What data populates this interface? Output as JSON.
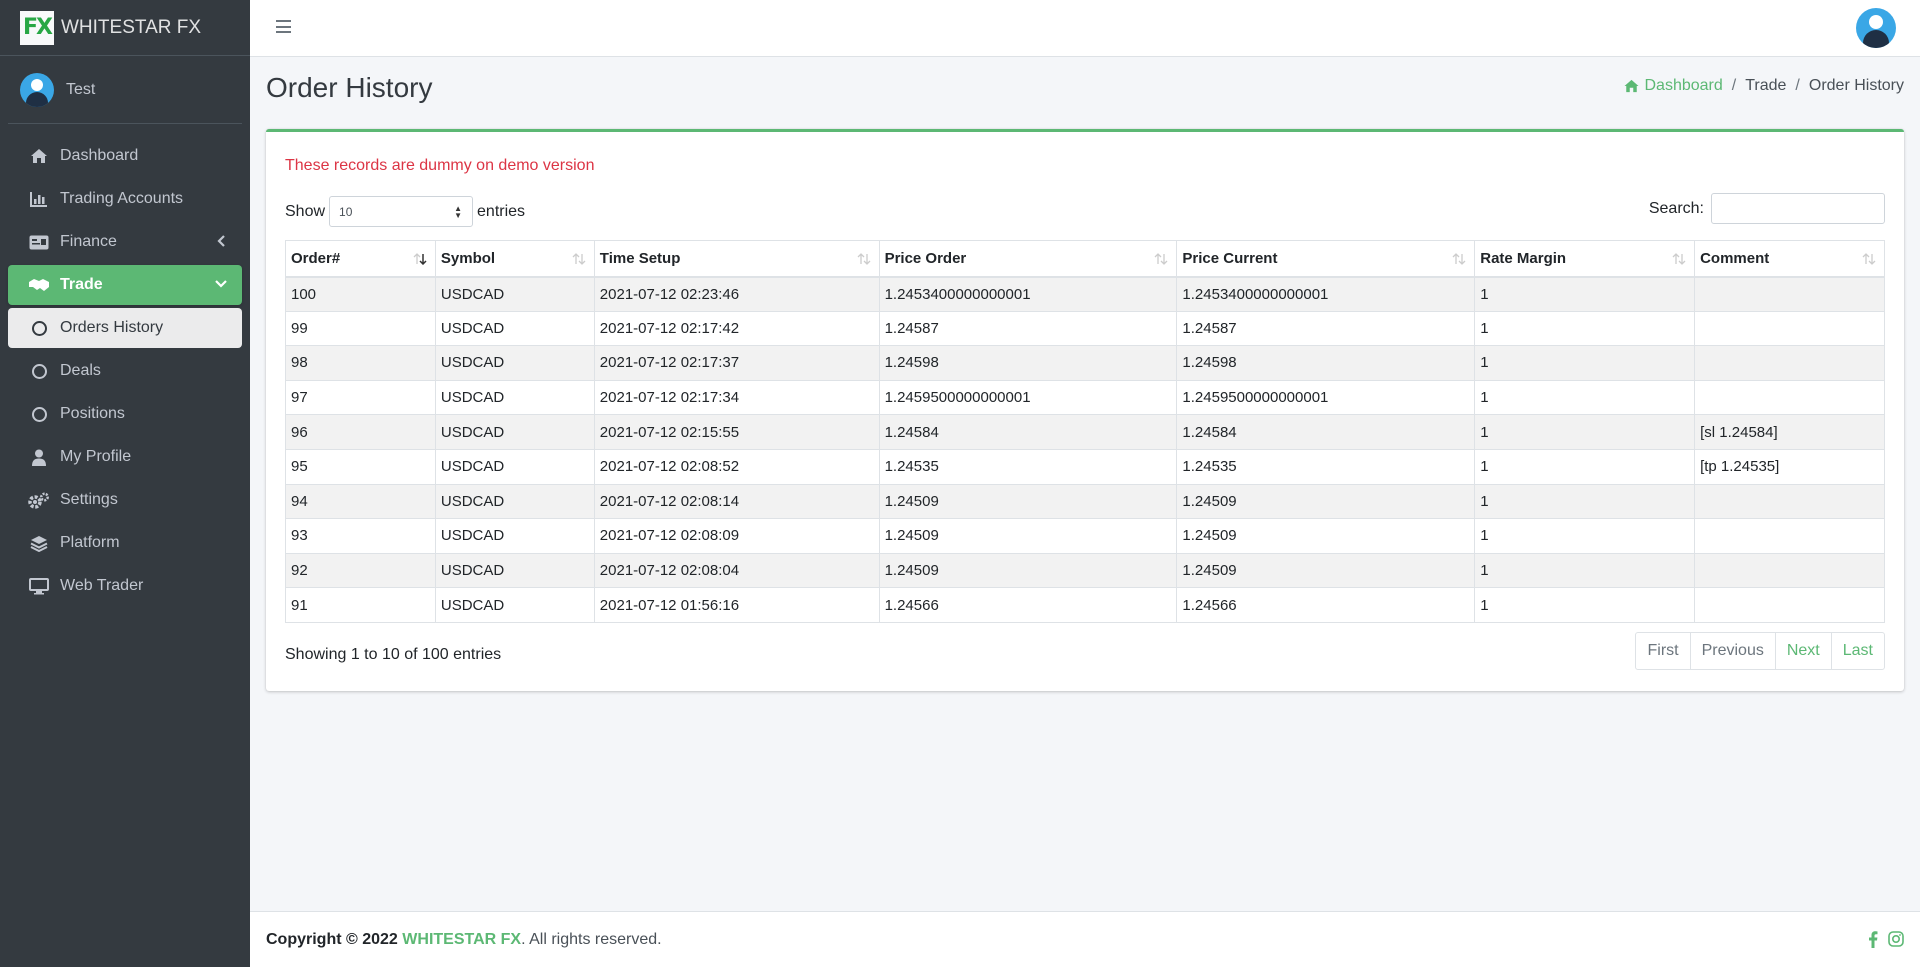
{
  "brand": {
    "logo_text": "FX",
    "name": "WHITESTAR FX"
  },
  "user": {
    "name": "Test"
  },
  "sidebar": {
    "items": [
      {
        "label": "Dashboard",
        "icon": "home-icon"
      },
      {
        "label": "Trading Accounts",
        "icon": "chart-bar-icon"
      },
      {
        "label": "Finance",
        "icon": "money-card-icon"
      },
      {
        "label": "Trade",
        "icon": "handshake-icon"
      },
      {
        "label": "Orders History",
        "icon": "circle-icon"
      },
      {
        "label": "Deals",
        "icon": "circle-icon"
      },
      {
        "label": "Positions",
        "icon": "circle-icon"
      },
      {
        "label": "My Profile",
        "icon": "user-icon"
      },
      {
        "label": "Settings",
        "icon": "cogs-icon"
      },
      {
        "label": "Platform",
        "icon": "layers-icon"
      },
      {
        "label": "Web Trader",
        "icon": "desktop-icon"
      }
    ]
  },
  "page": {
    "title": "Order History"
  },
  "breadcrumb": {
    "home": "Dashboard",
    "trade": "Trade",
    "current": "Order History"
  },
  "card": {
    "demo_note": "These records are dummy on demo version",
    "show_label": "Show",
    "entries_value": "10",
    "entries_label": "entries",
    "search_label": "Search:",
    "info": "Showing 1 to 10 of 100 entries"
  },
  "table": {
    "headers": [
      "Order#",
      "Symbol",
      "Time Setup",
      "Price Order",
      "Price Current",
      "Rate Margin",
      "Comment"
    ],
    "rows": [
      [
        "100",
        "USDCAD",
        "2021-07-12 02:23:46",
        "1.2453400000000001",
        "1.2453400000000001",
        "1",
        ""
      ],
      [
        "99",
        "USDCAD",
        "2021-07-12 02:17:42",
        "1.24587",
        "1.24587",
        "1",
        ""
      ],
      [
        "98",
        "USDCAD",
        "2021-07-12 02:17:37",
        "1.24598",
        "1.24598",
        "1",
        ""
      ],
      [
        "97",
        "USDCAD",
        "2021-07-12 02:17:34",
        "1.2459500000000001",
        "1.2459500000000001",
        "1",
        ""
      ],
      [
        "96",
        "USDCAD",
        "2021-07-12 02:15:55",
        "1.24584",
        "1.24584",
        "1",
        "[sl 1.24584]"
      ],
      [
        "95",
        "USDCAD",
        "2021-07-12 02:08:52",
        "1.24535",
        "1.24535",
        "1",
        "[tp 1.24535]"
      ],
      [
        "94",
        "USDCAD",
        "2021-07-12 02:08:14",
        "1.24509",
        "1.24509",
        "1",
        ""
      ],
      [
        "93",
        "USDCAD",
        "2021-07-12 02:08:09",
        "1.24509",
        "1.24509",
        "1",
        ""
      ],
      [
        "92",
        "USDCAD",
        "2021-07-12 02:08:04",
        "1.24509",
        "1.24509",
        "1",
        ""
      ],
      [
        "91",
        "USDCAD",
        "2021-07-12 01:56:16",
        "1.24566",
        "1.24566",
        "1",
        ""
      ]
    ]
  },
  "pagination": {
    "first": "First",
    "previous": "Previous",
    "next": "Next",
    "last": "Last"
  },
  "footer": {
    "copyright": "Copyright © 2022",
    "brand": "WHITESTAR FX",
    "rights": ". All rights reserved."
  },
  "colors": {
    "accent": "#5cb874",
    "sidebar": "#343a40",
    "danger": "#dc3545"
  }
}
